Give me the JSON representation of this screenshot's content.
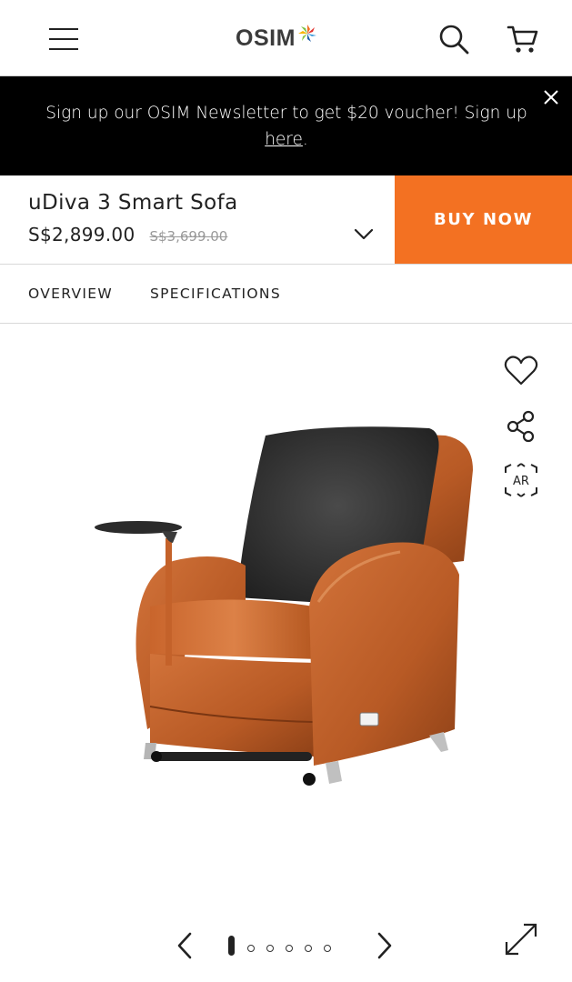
{
  "header": {
    "logo_text": "OSIM",
    "menu_icon": "hamburger-menu-icon",
    "search_icon": "search-icon",
    "cart_icon": "cart-icon"
  },
  "banner": {
    "text_before": "Sign up our OSIM Newsletter to get $20 voucher! Sign up ",
    "link_text": "here",
    "text_after": ".",
    "close_icon": "close-icon"
  },
  "product": {
    "name": "uDiva 3 Smart Sofa",
    "price": "S$2,899.00",
    "original_price": "S$3,699.00",
    "buy_label": "BUY NOW"
  },
  "tabs": [
    {
      "label": "OVERVIEW"
    },
    {
      "label": "SPECIFICATIONS"
    }
  ],
  "gallery": {
    "ar_label": "AR",
    "slide_count": 6,
    "current_slide": 1
  },
  "colors": {
    "accent": "#f37122",
    "banner_bg": "#000000",
    "chair_leather": "#c4622a",
    "cushion": "#2e2e2e"
  }
}
